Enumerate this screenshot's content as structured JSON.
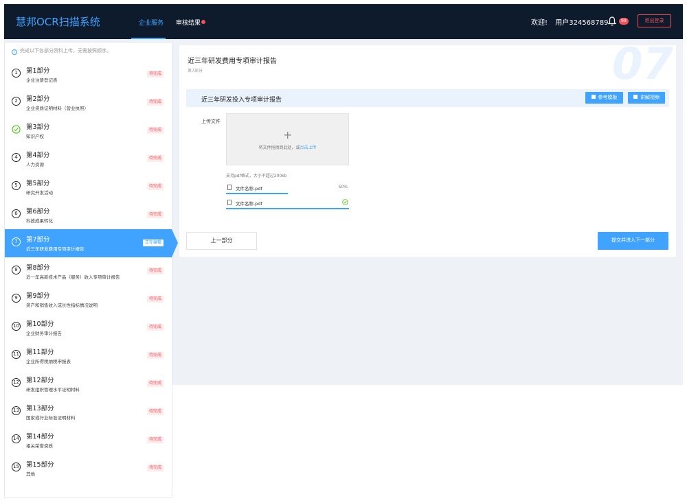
{
  "header": {
    "logo": "慧邦OCR扫描系统",
    "tabs": [
      {
        "label": "企业服务"
      },
      {
        "label": "审核结果"
      }
    ],
    "welcome": "欢迎!",
    "username": "用户324568789",
    "badge_count": "99",
    "logout_label": "退出登录",
    "accent_color": "#3fa3ff"
  },
  "sidebar": {
    "tip": "完成以下各部分资料上传，无需按照顺序。",
    "items": [
      {
        "num": "1",
        "title": "第1部分",
        "subtitle": "企业注册登记表",
        "status": "待完成"
      },
      {
        "num": "2",
        "title": "第2部分",
        "subtitle": "企业资质证明材料（营业执照）",
        "status": "待完成"
      },
      {
        "num": "3",
        "title": "第3部分",
        "subtitle": "知识产权",
        "status": "待完成",
        "completed": true
      },
      {
        "num": "4",
        "title": "第4部分",
        "subtitle": "人力资源",
        "status": "待完成"
      },
      {
        "num": "5",
        "title": "第5部分",
        "subtitle": "研究开发活动",
        "status": "待完成"
      },
      {
        "num": "6",
        "title": "第6部分",
        "subtitle": "科技成果转化",
        "status": "待完成"
      },
      {
        "num": "7",
        "title": "第7部分",
        "subtitle": "近三年研发费用专项审计报告",
        "status": "正在编辑",
        "active": true
      },
      {
        "num": "8",
        "title": "第8部分",
        "subtitle": "近一年高新技术产品（服务）收入专项审计报告",
        "status": "待完成"
      },
      {
        "num": "9",
        "title": "第9部分",
        "subtitle": "资产和销售收入成长性指标情况说明",
        "status": "待完成"
      },
      {
        "num": "10",
        "title": "第10部分",
        "subtitle": "企业财务审计报告",
        "status": "待完成"
      },
      {
        "num": "11",
        "title": "第11部分",
        "subtitle": "企业所得税纳税申报表",
        "status": "待完成"
      },
      {
        "num": "12",
        "title": "第12部分",
        "subtitle": "研发组织管理水平证明材料",
        "status": "待完成"
      },
      {
        "num": "13",
        "title": "第13部分",
        "subtitle": "国家或行业标准证明材料",
        "status": "待完成"
      },
      {
        "num": "14",
        "title": "第14部分",
        "subtitle": "相关荣誉资质",
        "status": "待完成"
      },
      {
        "num": "15",
        "title": "第15部分",
        "subtitle": "其他",
        "status": "待完成"
      }
    ]
  },
  "main": {
    "title": "近三年研发费用专项审计报告",
    "subtitle": "第7部分",
    "big_number": "07",
    "section_title": "近三年研发投入专项审计报告",
    "template_button": "参考模板",
    "video_button": "讲解视频",
    "upload_label": "上传文件",
    "drop_text": "将文件拖拽到此处，或",
    "drop_link": "点击上传",
    "support_text": "支持pdf格式，大小不超过200kb",
    "files": [
      {
        "name": "文件名称.pdf",
        "progress_text": "50%",
        "progress": 0.5
      },
      {
        "name": "文件名称.pdf",
        "progress": 1.0,
        "done": true
      }
    ],
    "prev_button": "上一部分",
    "next_button": "提交并进入下一部分"
  }
}
